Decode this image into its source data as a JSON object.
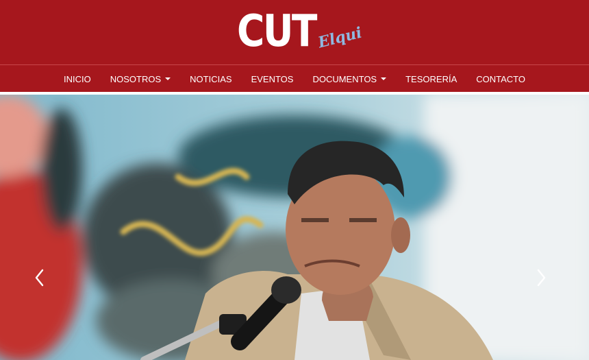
{
  "brand": {
    "logo_main": "CUT",
    "logo_sub": "Elqui"
  },
  "nav": {
    "items": [
      {
        "label": "INICIO",
        "dropdown": false
      },
      {
        "label": "NOSOTROS",
        "dropdown": true
      },
      {
        "label": "NOTICIAS",
        "dropdown": false
      },
      {
        "label": "EVENTOS",
        "dropdown": false
      },
      {
        "label": "DOCUMENTOS",
        "dropdown": true
      },
      {
        "label": "TESORERÍA",
        "dropdown": false
      },
      {
        "label": "CONTACTO",
        "dropdown": false
      }
    ]
  },
  "carousel": {
    "prev_icon": "chevron-left-icon",
    "next_icon": "chevron-right-icon"
  },
  "colors": {
    "brand_red": "#a6171d",
    "logo_blue": "#8fb8e0",
    "white": "#ffffff"
  }
}
